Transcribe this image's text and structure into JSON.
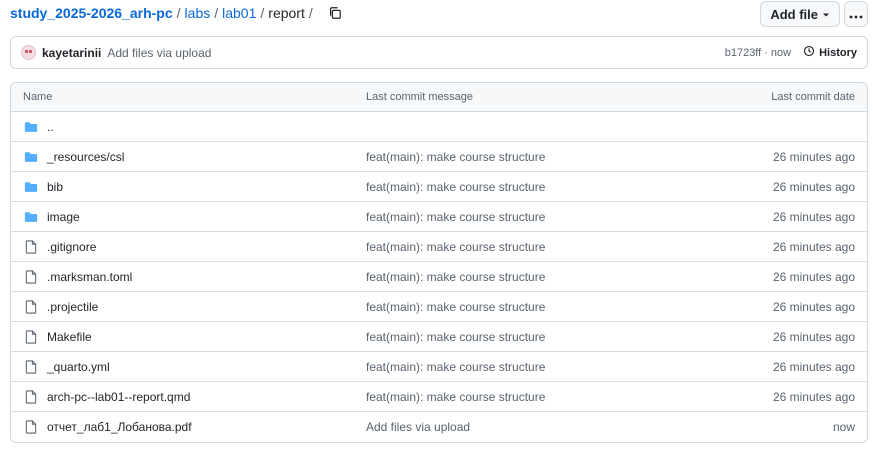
{
  "breadcrumb": {
    "repo": "study_2025-2026_arh-pc",
    "separator": "/",
    "parts": [
      "labs",
      "lab01"
    ],
    "current": "report"
  },
  "actions": {
    "add_file": "Add file",
    "more_icon": "kebab-horizontal-icon",
    "copy_icon": "copy-icon"
  },
  "commit": {
    "author": "kayetarinii",
    "message": "Add files via upload",
    "sha": "b1723ff",
    "separator": "·",
    "time": "now",
    "history_label": "History"
  },
  "table": {
    "headers": {
      "name": "Name",
      "message": "Last commit message",
      "date": "Last commit date"
    },
    "parent": "..",
    "rows": [
      {
        "type": "folder",
        "name": "_resources/csl",
        "message": "feat(main): make course structure",
        "date": "26 minutes ago"
      },
      {
        "type": "folder",
        "name": "bib",
        "message": "feat(main): make course structure",
        "date": "26 minutes ago"
      },
      {
        "type": "folder",
        "name": "image",
        "message": "feat(main): make course structure",
        "date": "26 minutes ago"
      },
      {
        "type": "file",
        "name": ".gitignore",
        "message": "feat(main): make course structure",
        "date": "26 minutes ago"
      },
      {
        "type": "file",
        "name": ".marksman.toml",
        "message": "feat(main): make course structure",
        "date": "26 minutes ago"
      },
      {
        "type": "file",
        "name": ".projectile",
        "message": "feat(main): make course structure",
        "date": "26 minutes ago"
      },
      {
        "type": "file",
        "name": "Makefile",
        "message": "feat(main): make course structure",
        "date": "26 minutes ago"
      },
      {
        "type": "file",
        "name": "_quarto.yml",
        "message": "feat(main): make course structure",
        "date": "26 minutes ago"
      },
      {
        "type": "file",
        "name": "arch-pc--lab01--report.qmd",
        "message": "feat(main): make course structure",
        "date": "26 minutes ago"
      },
      {
        "type": "file",
        "name": "отчет_лаб1_Лобанова.pdf",
        "message": "Add files via upload",
        "date": "now"
      }
    ]
  },
  "colors": {
    "link": "#0969da",
    "folder": "#54aeff",
    "muted": "#59636e",
    "border": "#d1d9e0"
  }
}
